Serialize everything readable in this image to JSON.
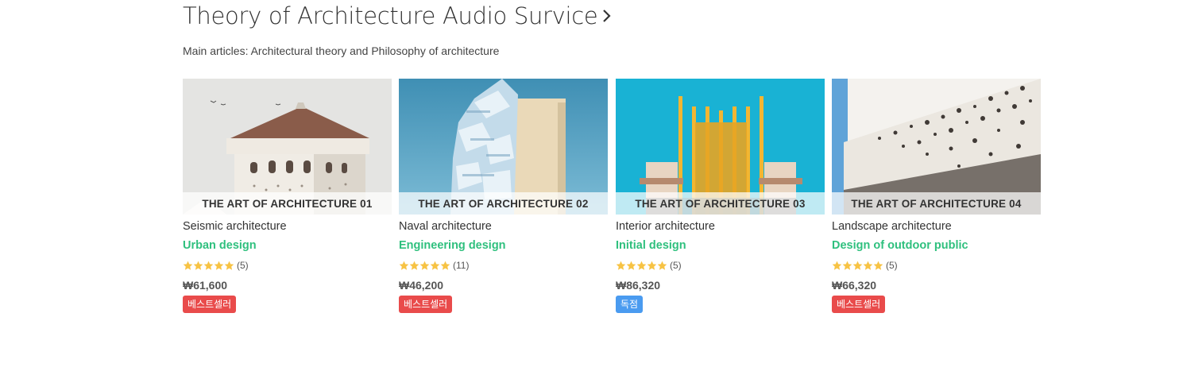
{
  "header": {
    "title": "Theory of Architecture Audio Survice",
    "subtitle": "Main articles: Architectural theory and Philosophy of architecture"
  },
  "colors": {
    "category_green": "#2fc07e",
    "star": "#f7c344",
    "badge_red": "#e94b4b",
    "badge_blue": "#4a9bf0"
  },
  "products": [
    {
      "overlay": "THE ART OF ARCHITECTURE 01",
      "name": "Seismic architecture",
      "category": "Urban design",
      "rating": 5,
      "count": "(5)",
      "price": "₩61,600",
      "badge": "베스트셀러",
      "badge_color": "#e94b4b"
    },
    {
      "overlay": "THE ART OF ARCHITECTURE 02",
      "name": "Naval architecture",
      "category": "Engineering design",
      "rating": 5,
      "count": "(11)",
      "price": "₩46,200",
      "badge": "베스트셀러",
      "badge_color": "#e94b4b"
    },
    {
      "overlay": "THE ART OF ARCHITECTURE 03",
      "name": "Interior architecture",
      "category": "Initial design",
      "rating": 5,
      "count": "(5)",
      "price": "₩86,320",
      "badge": "독점",
      "badge_color": "#4a9bf0"
    },
    {
      "overlay": "THE ART OF ARCHITECTURE 04",
      "name": "Landscape architecture",
      "category": "Design of outdoor public",
      "rating": 5,
      "count": "(5)",
      "price": "₩66,320",
      "badge": "베스트셀러",
      "badge_color": "#e94b4b"
    }
  ]
}
